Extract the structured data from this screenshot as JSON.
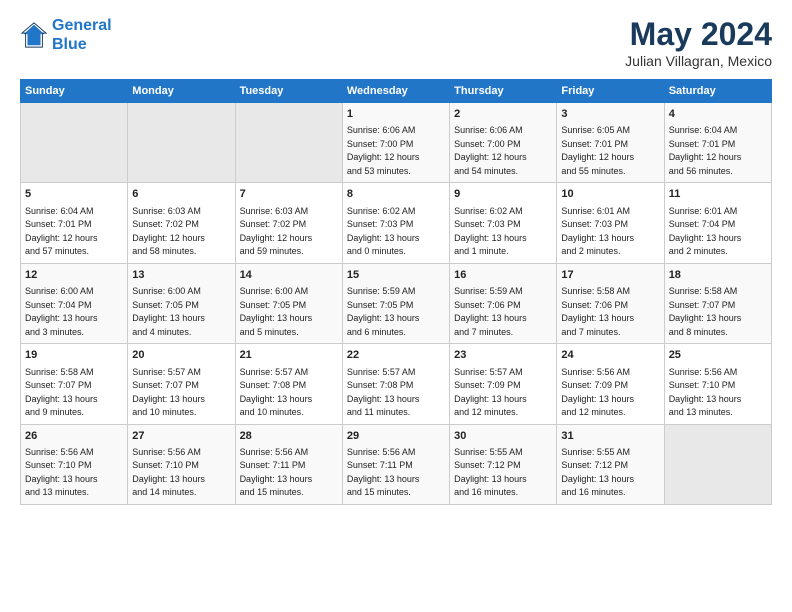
{
  "header": {
    "logo_line1": "General",
    "logo_line2": "Blue",
    "title": "May 2024",
    "subtitle": "Julian Villagran, Mexico"
  },
  "days_of_week": [
    "Sunday",
    "Monday",
    "Tuesday",
    "Wednesday",
    "Thursday",
    "Friday",
    "Saturday"
  ],
  "weeks": [
    [
      {
        "day": "",
        "info": ""
      },
      {
        "day": "",
        "info": ""
      },
      {
        "day": "",
        "info": ""
      },
      {
        "day": "1",
        "info": "Sunrise: 6:06 AM\nSunset: 7:00 PM\nDaylight: 12 hours\nand 53 minutes."
      },
      {
        "day": "2",
        "info": "Sunrise: 6:06 AM\nSunset: 7:00 PM\nDaylight: 12 hours\nand 54 minutes."
      },
      {
        "day": "3",
        "info": "Sunrise: 6:05 AM\nSunset: 7:01 PM\nDaylight: 12 hours\nand 55 minutes."
      },
      {
        "day": "4",
        "info": "Sunrise: 6:04 AM\nSunset: 7:01 PM\nDaylight: 12 hours\nand 56 minutes."
      }
    ],
    [
      {
        "day": "5",
        "info": "Sunrise: 6:04 AM\nSunset: 7:01 PM\nDaylight: 12 hours\nand 57 minutes."
      },
      {
        "day": "6",
        "info": "Sunrise: 6:03 AM\nSunset: 7:02 PM\nDaylight: 12 hours\nand 58 minutes."
      },
      {
        "day": "7",
        "info": "Sunrise: 6:03 AM\nSunset: 7:02 PM\nDaylight: 12 hours\nand 59 minutes."
      },
      {
        "day": "8",
        "info": "Sunrise: 6:02 AM\nSunset: 7:03 PM\nDaylight: 13 hours\nand 0 minutes."
      },
      {
        "day": "9",
        "info": "Sunrise: 6:02 AM\nSunset: 7:03 PM\nDaylight: 13 hours\nand 1 minute."
      },
      {
        "day": "10",
        "info": "Sunrise: 6:01 AM\nSunset: 7:03 PM\nDaylight: 13 hours\nand 2 minutes."
      },
      {
        "day": "11",
        "info": "Sunrise: 6:01 AM\nSunset: 7:04 PM\nDaylight: 13 hours\nand 2 minutes."
      }
    ],
    [
      {
        "day": "12",
        "info": "Sunrise: 6:00 AM\nSunset: 7:04 PM\nDaylight: 13 hours\nand 3 minutes."
      },
      {
        "day": "13",
        "info": "Sunrise: 6:00 AM\nSunset: 7:05 PM\nDaylight: 13 hours\nand 4 minutes."
      },
      {
        "day": "14",
        "info": "Sunrise: 6:00 AM\nSunset: 7:05 PM\nDaylight: 13 hours\nand 5 minutes."
      },
      {
        "day": "15",
        "info": "Sunrise: 5:59 AM\nSunset: 7:05 PM\nDaylight: 13 hours\nand 6 minutes."
      },
      {
        "day": "16",
        "info": "Sunrise: 5:59 AM\nSunset: 7:06 PM\nDaylight: 13 hours\nand 7 minutes."
      },
      {
        "day": "17",
        "info": "Sunrise: 5:58 AM\nSunset: 7:06 PM\nDaylight: 13 hours\nand 7 minutes."
      },
      {
        "day": "18",
        "info": "Sunrise: 5:58 AM\nSunset: 7:07 PM\nDaylight: 13 hours\nand 8 minutes."
      }
    ],
    [
      {
        "day": "19",
        "info": "Sunrise: 5:58 AM\nSunset: 7:07 PM\nDaylight: 13 hours\nand 9 minutes."
      },
      {
        "day": "20",
        "info": "Sunrise: 5:57 AM\nSunset: 7:07 PM\nDaylight: 13 hours\nand 10 minutes."
      },
      {
        "day": "21",
        "info": "Sunrise: 5:57 AM\nSunset: 7:08 PM\nDaylight: 13 hours\nand 10 minutes."
      },
      {
        "day": "22",
        "info": "Sunrise: 5:57 AM\nSunset: 7:08 PM\nDaylight: 13 hours\nand 11 minutes."
      },
      {
        "day": "23",
        "info": "Sunrise: 5:57 AM\nSunset: 7:09 PM\nDaylight: 13 hours\nand 12 minutes."
      },
      {
        "day": "24",
        "info": "Sunrise: 5:56 AM\nSunset: 7:09 PM\nDaylight: 13 hours\nand 12 minutes."
      },
      {
        "day": "25",
        "info": "Sunrise: 5:56 AM\nSunset: 7:10 PM\nDaylight: 13 hours\nand 13 minutes."
      }
    ],
    [
      {
        "day": "26",
        "info": "Sunrise: 5:56 AM\nSunset: 7:10 PM\nDaylight: 13 hours\nand 13 minutes."
      },
      {
        "day": "27",
        "info": "Sunrise: 5:56 AM\nSunset: 7:10 PM\nDaylight: 13 hours\nand 14 minutes."
      },
      {
        "day": "28",
        "info": "Sunrise: 5:56 AM\nSunset: 7:11 PM\nDaylight: 13 hours\nand 15 minutes."
      },
      {
        "day": "29",
        "info": "Sunrise: 5:56 AM\nSunset: 7:11 PM\nDaylight: 13 hours\nand 15 minutes."
      },
      {
        "day": "30",
        "info": "Sunrise: 5:55 AM\nSunset: 7:12 PM\nDaylight: 13 hours\nand 16 minutes."
      },
      {
        "day": "31",
        "info": "Sunrise: 5:55 AM\nSunset: 7:12 PM\nDaylight: 13 hours\nand 16 minutes."
      },
      {
        "day": "",
        "info": ""
      }
    ]
  ]
}
